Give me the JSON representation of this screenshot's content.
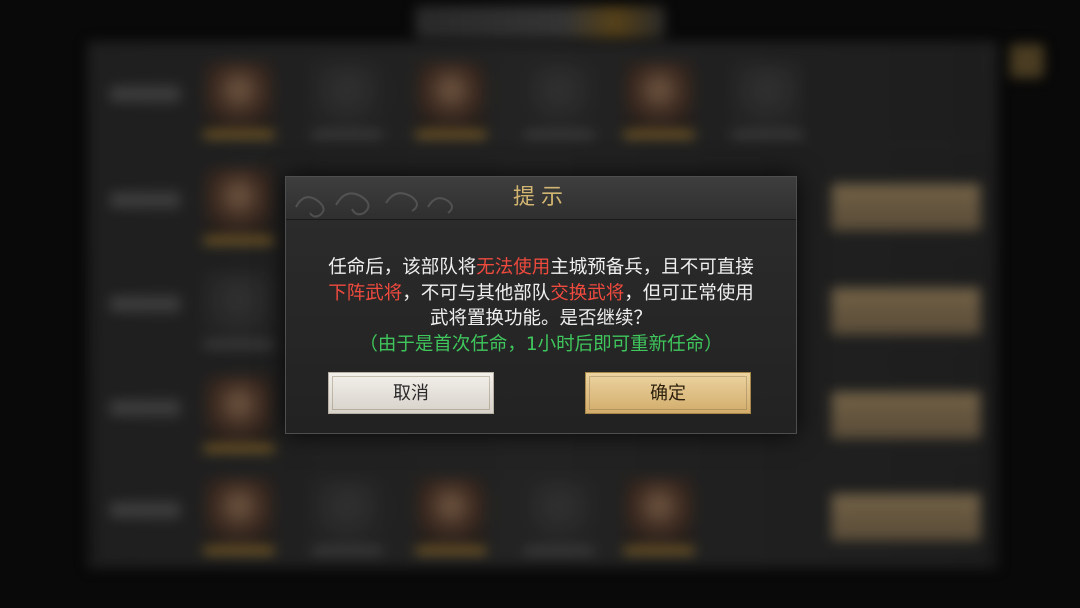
{
  "dialog": {
    "title": "提示",
    "message": {
      "l1_a": "任命后，该部队将",
      "l1_red": "无法使用",
      "l1_b": "主城预备兵，且不可直接",
      "l2_red1": "下阵武将",
      "l2_a": "，不可与其他部队",
      "l2_red2": "交换武将",
      "l2_b": "，但可正常使用",
      "l3": "武将置换功能。是否继续？",
      "note": "（由于是首次任命，1小时后即可重新任命）"
    },
    "cancel_label": "取消",
    "confirm_label": "确定"
  },
  "colors": {
    "title": "#d2b571",
    "warning_text": "#ef4a3e",
    "note_text": "#3fc65c",
    "confirm_button": "#ddbd80",
    "cancel_button": "#e6e2dc"
  },
  "icons": [
    "settings-icon"
  ]
}
